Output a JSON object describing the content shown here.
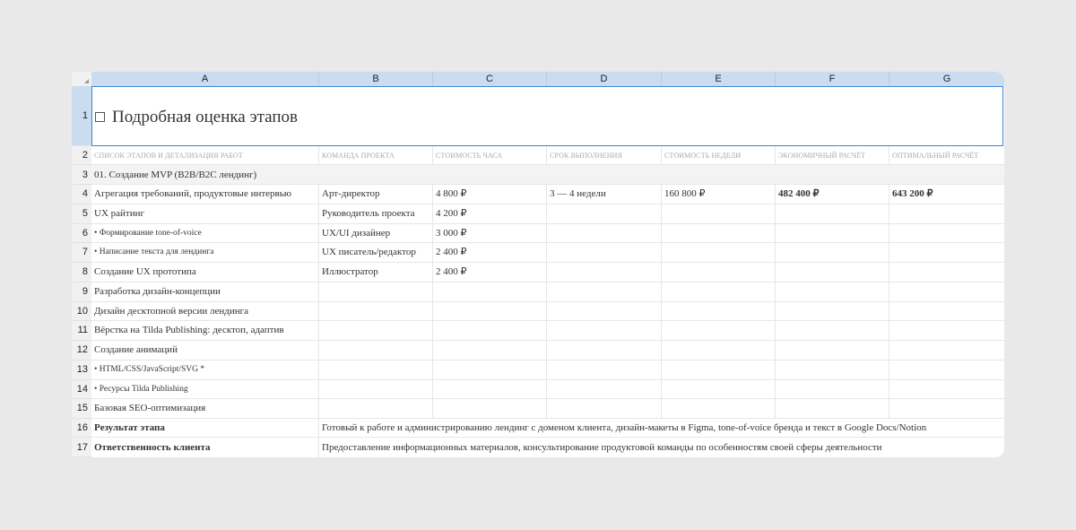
{
  "columns": [
    "A",
    "B",
    "C",
    "D",
    "E",
    "F",
    "G"
  ],
  "title": "Подробная оценка этапов",
  "header_row": {
    "num": "2",
    "cells": [
      "Список этапов и детализация работ",
      "Команда проекта",
      "Стоимость часа",
      "Срок выполнения",
      "Стоимость недели",
      "Экономичный расчёт",
      "Оптимальный расчёт"
    ]
  },
  "section_row": {
    "num": "3",
    "label": "01. Создание MVP (B2B/B2C лендинг)"
  },
  "rows": [
    {
      "num": "4",
      "a": "Агрегация требований, продуктовые интервью",
      "b": "Арт-директор",
      "c": "4 800 ₽",
      "d": "3 — 4 недели",
      "e": "160 800 ₽",
      "f": "482 400 ₽",
      "g": "643 200 ₽"
    },
    {
      "num": "5",
      "a": "UX райтинг",
      "b": "Руководитель проекта",
      "c": "4 200 ₽",
      "d": "",
      "e": "",
      "f": "",
      "g": ""
    },
    {
      "num": "6",
      "a": "• Формирование tone-of-voice",
      "b": "UX/UI дизайнер",
      "c": "3 000 ₽",
      "d": "",
      "e": "",
      "f": "",
      "g": ""
    },
    {
      "num": "7",
      "a": "• Написание текста для лендинга",
      "b": "UX писатель/редактор",
      "c": "2 400 ₽",
      "d": "",
      "e": "",
      "f": "",
      "g": ""
    },
    {
      "num": "8",
      "a": "Создание UX прототипа",
      "b": "Иллюстратор",
      "c": "2 400 ₽",
      "d": "",
      "e": "",
      "f": "",
      "g": ""
    },
    {
      "num": "9",
      "a": "Разработка дизайн-концепции",
      "b": "",
      "c": "",
      "d": "",
      "e": "",
      "f": "",
      "g": ""
    },
    {
      "num": "10",
      "a": "Дизайн десктопной версии лендинга",
      "b": "",
      "c": "",
      "d": "",
      "e": "",
      "f": "",
      "g": ""
    },
    {
      "num": "11",
      "a": "Вёрстка на Tilda Publishing: десктоп, адаптив",
      "b": "",
      "c": "",
      "d": "",
      "e": "",
      "f": "",
      "g": ""
    },
    {
      "num": "12",
      "a": "Создание анимаций",
      "b": "",
      "c": "",
      "d": "",
      "e": "",
      "f": "",
      "g": ""
    },
    {
      "num": "13",
      "a": "• HTML/CSS/JavaScript/SVG *",
      "b": "",
      "c": "",
      "d": "",
      "e": "",
      "f": "",
      "g": ""
    },
    {
      "num": "14",
      "a": "• Ресурсы Tilda Publishing",
      "b": "",
      "c": "",
      "d": "",
      "e": "",
      "f": "",
      "g": ""
    },
    {
      "num": "15",
      "a": "Базовая SEO-оптимизация",
      "b": "",
      "c": "",
      "d": "",
      "e": "",
      "f": "",
      "g": ""
    }
  ],
  "result_row": {
    "num": "16",
    "label": "Результат этапа",
    "text": "Готовый к работе и администрированию лендинг с доменом клиента, дизайн-макеты в Figma, tone-of-voice бренда и текст в Google Docs/Notion"
  },
  "client_row": {
    "num": "17",
    "label": "Ответственность клиента",
    "text": "Предоставление информационных материалов, консультирование продуктовой команды по особенностям своей сферы деятельности"
  },
  "row1_num": "1"
}
